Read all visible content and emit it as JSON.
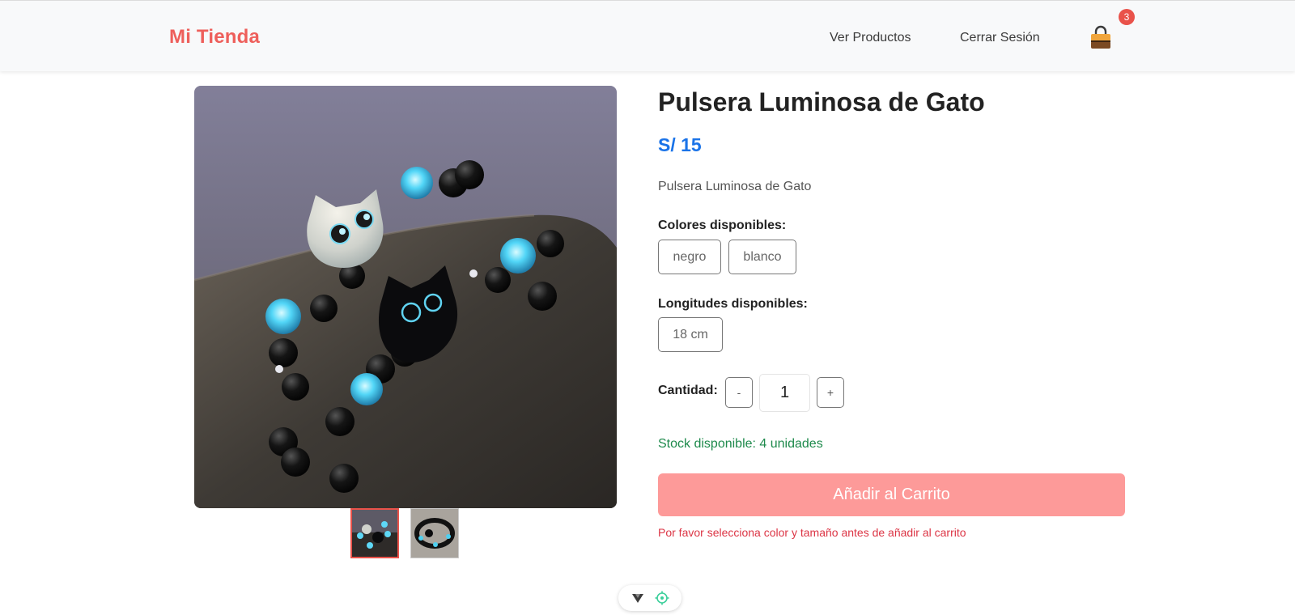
{
  "header": {
    "brand": "Mi Tienda",
    "nav": [
      {
        "label": "Ver Productos"
      },
      {
        "label": "Cerrar Sesión"
      }
    ],
    "cart_count": "3",
    "cart_icon": "shopping-bag-icon"
  },
  "product": {
    "title": "Pulsera Luminosa de Gato",
    "price": "S/ 15",
    "description": "Pulsera Luminosa de Gato",
    "colors_label": "Colores disponibles:",
    "colors": [
      "negro",
      "blanco"
    ],
    "lengths_label": "Longitudes disponibles:",
    "lengths": [
      "18 cm"
    ],
    "quantity_label": "Cantidad:",
    "quantity_minus": "-",
    "quantity_value": "1",
    "quantity_plus": "+",
    "stock": "Stock disponible: 4 unidades",
    "add_to_cart": "Añadir al Carrito",
    "warning": "Por favor selecciona color y tamaño antes de añadir al carrito"
  },
  "gallery": {
    "main_image": "cat-bracelet-photo",
    "thumbnails": [
      "cat-bracelet-thumb-1",
      "cat-bracelet-thumb-2"
    ],
    "selected_thumbnail": 1
  },
  "widget": {
    "icons": [
      "filter-icon",
      "target-icon"
    ]
  },
  "colors": {
    "brand": "#ee5f5b",
    "price": "#1a73e8",
    "stock": "#1e8a4c",
    "button": "#fd9a99",
    "warning": "#dc3545",
    "badge": "#e9524a"
  }
}
